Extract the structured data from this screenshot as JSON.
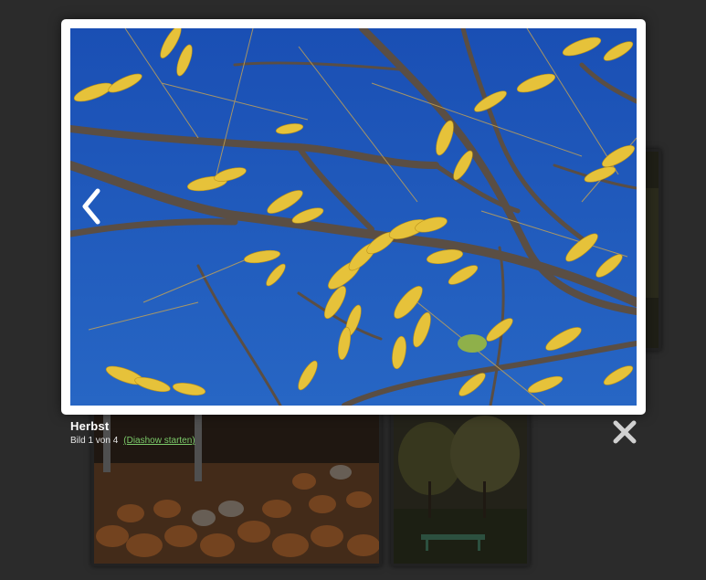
{
  "lightbox": {
    "image_alt": "Herbst",
    "title": "Herbst",
    "counter": "Bild 1 von 4",
    "slideshow_link": "(Diashow starten)",
    "prev_icon": "chevron-left-icon",
    "close_icon": "close-icon"
  },
  "colors": {
    "backdrop": "#3a3a3a",
    "frame": "#ffffff",
    "sky": "#1f56b8",
    "link": "#7ccb6a"
  }
}
